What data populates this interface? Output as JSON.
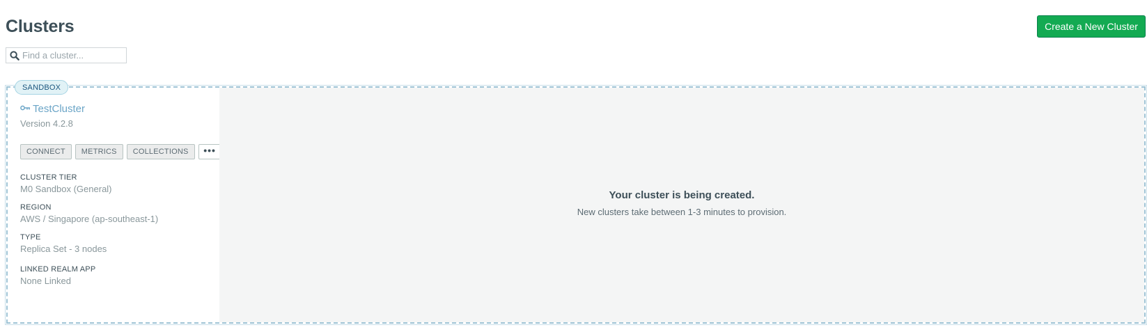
{
  "page": {
    "title": "Clusters",
    "create_button_label": "Create a New Cluster"
  },
  "search": {
    "placeholder": "Find a cluster...",
    "value": ""
  },
  "cluster": {
    "badge": "SANDBOX",
    "name": "TestCluster",
    "name_icon": "key-icon",
    "version": "Version 4.2.8",
    "actions": {
      "connect": "CONNECT",
      "metrics": "METRICS",
      "collections": "COLLECTIONS",
      "more": "•••"
    },
    "details": [
      {
        "label": "CLUSTER TIER",
        "value": "M0 Sandbox (General)"
      },
      {
        "label": "REGION",
        "value": "AWS / Singapore (ap-southeast-1)"
      },
      {
        "label": "TYPE",
        "value": "Replica Set - 3 nodes"
      },
      {
        "label": "LINKED REALM APP",
        "value": "None Linked"
      }
    ]
  },
  "status": {
    "title": "Your cluster is being created.",
    "message": "New clusters take between 1-3 minutes to provision."
  },
  "colors": {
    "primary_button": "#13aa52",
    "cluster_link": "#6ba5c7",
    "badge_bg": "#e1f2f6",
    "panel_bg": "#f4f5f5"
  }
}
